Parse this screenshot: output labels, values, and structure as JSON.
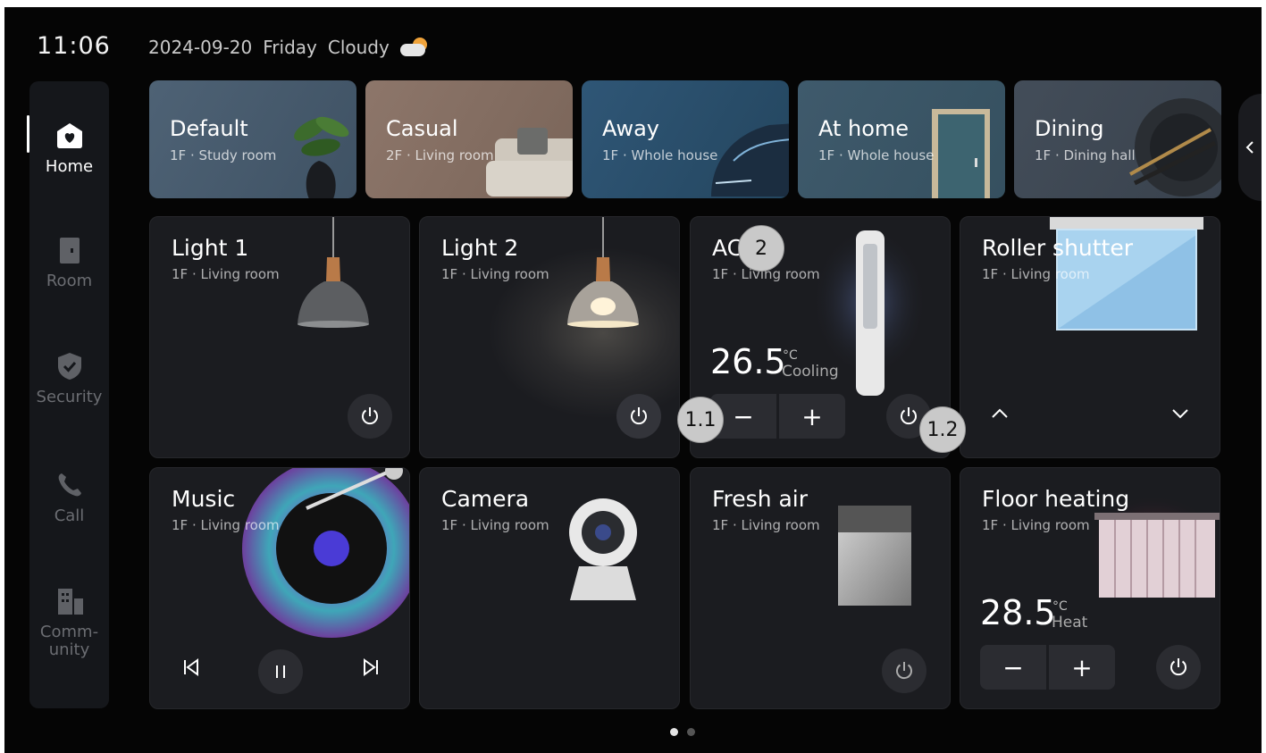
{
  "status": {
    "time": "11:06",
    "date": "2024-09-20",
    "weekday": "Friday",
    "weather": "Cloudy"
  },
  "nav": {
    "items": [
      {
        "label": "Home",
        "icon": "home-heart-icon"
      },
      {
        "label": "Room",
        "icon": "door-icon"
      },
      {
        "label": "Security",
        "icon": "shield-icon"
      },
      {
        "label": "Call",
        "icon": "phone-icon"
      },
      {
        "label": "Comm-",
        "label2": "unity",
        "icon": "buildings-icon"
      }
    ]
  },
  "scenes": [
    {
      "title": "Default",
      "sub": "1F · Study room"
    },
    {
      "title": "Casual",
      "sub": "2F · Living room"
    },
    {
      "title": "Away",
      "sub": "1F · Whole house"
    },
    {
      "title": "At home",
      "sub": "1F · Whole house"
    },
    {
      "title": "Dining",
      "sub": "1F · Dining hall"
    }
  ],
  "devices": {
    "light1": {
      "title": "Light 1",
      "sub": "1F · Living room"
    },
    "light2": {
      "title": "Light 2",
      "sub": "1F · Living room"
    },
    "ac": {
      "title": "AC",
      "sub": "1F · Living room",
      "temp": "26.5",
      "unit": "°C",
      "mode": "Cooling",
      "minus": "−",
      "plus": "+"
    },
    "shutter": {
      "title": "Roller shutter",
      "sub": "1F · Living room"
    },
    "music": {
      "title": "Music",
      "sub": "1F · Living room"
    },
    "camera": {
      "title": "Camera",
      "sub": "1F · Living room"
    },
    "freshair": {
      "title": "Fresh air",
      "sub": "1F · Living room"
    },
    "floorheat": {
      "title": "Floor heating",
      "sub": "1F · Living room",
      "temp": "28.5",
      "unit": "°C",
      "mode": "Heat",
      "minus": "−",
      "plus": "+"
    }
  },
  "annotations": {
    "b2": "2",
    "b11": "1.1",
    "b12": "1.2"
  },
  "colors": {
    "background": "#050505",
    "card": "#1b1c20",
    "sidebar": "#15171b",
    "button": "#2b2c31"
  }
}
